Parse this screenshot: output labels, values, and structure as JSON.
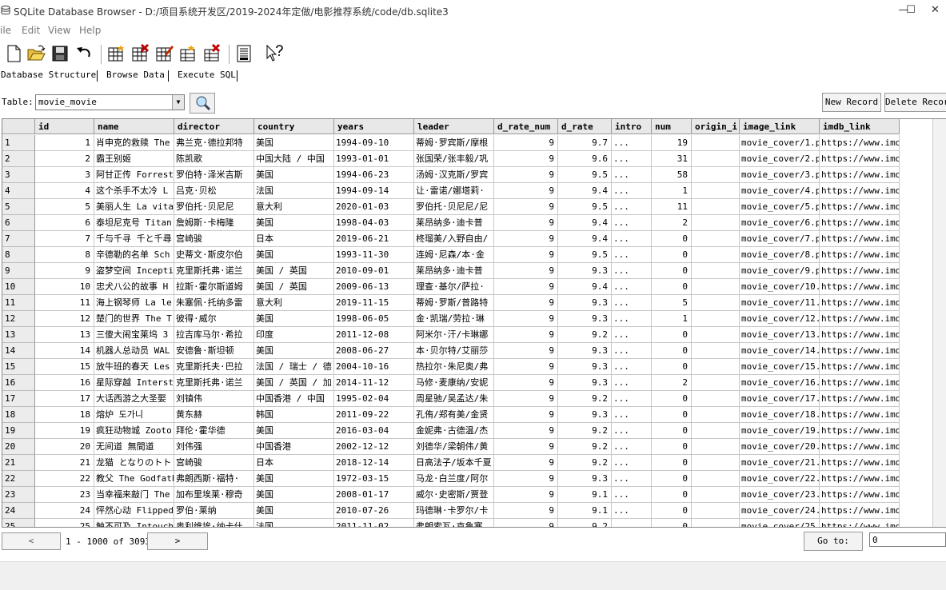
{
  "window": {
    "title": "SQLite Database Browser - D:/项目系统开发区/2019-2024年定做/电影推荐系统/code/db.sqlite3",
    "min": "—",
    "max": "☐",
    "close": "✕"
  },
  "menu": [
    "ile",
    "Edit",
    "View",
    "Help"
  ],
  "toolbar_icons": [
    "new-database-icon",
    "open-database-icon",
    "save-icon",
    "undo-icon",
    "create-table-icon",
    "delete-table-icon",
    "modify-table-icon",
    "create-index-icon",
    "delete-index-icon",
    "sql-log-icon",
    "whats-this-icon"
  ],
  "tabs": [
    "Database Structure",
    "Browse Data",
    "Execute SQL"
  ],
  "table_select": {
    "label": "Table:",
    "value": "movie_movie"
  },
  "buttons": {
    "new_record": "New Record",
    "delete_record": "Delete Recor"
  },
  "columns": [
    "id",
    "name",
    "director",
    "country",
    "years",
    "leader",
    "d_rate_num",
    "d_rate",
    "intro",
    "num",
    "origin_i",
    "image_link",
    "imdb_link"
  ],
  "rows": [
    [
      "1",
      "1",
      "肖申克的救赎 The",
      "弗兰克·德拉邦特",
      "美国",
      "1994-09-10",
      "蒂姆·罗宾斯/摩根",
      "9",
      "9.7",
      "...",
      "19",
      "",
      "movie_cover/1.pn",
      "https://www.imdb"
    ],
    [
      "2",
      "2",
      "霸王别姬",
      "陈凯歌",
      "中国大陆 / 中国",
      "1993-01-01",
      "张国荣/张丰毅/巩",
      "9",
      "9.6",
      "...",
      "31",
      "",
      "movie_cover/2.pn",
      "https://www.imdb"
    ],
    [
      "3",
      "3",
      "阿甘正传 Forrest",
      "罗伯特·泽米吉斯",
      "美国",
      "1994-06-23",
      "汤姆·汉克斯/罗宾",
      "9",
      "9.5",
      "...",
      "58",
      "",
      "movie_cover/3.pn",
      "https://www.imdb"
    ],
    [
      "4",
      "4",
      "这个杀手不太冷 L",
      "吕克·贝松",
      "法国",
      "1994-09-14",
      "让·雷诺/娜塔莉·",
      "9",
      "9.4",
      "...",
      "1",
      "",
      "movie_cover/4.pn",
      "https://www.imdb"
    ],
    [
      "5",
      "5",
      "美丽人生 La vita",
      "罗伯托·贝尼尼",
      "意大利",
      "2020-01-03",
      "罗伯托·贝尼尼/尼",
      "9",
      "9.5",
      "...",
      "11",
      "",
      "movie_cover/5.pn",
      "https://www.imdb"
    ],
    [
      "6",
      "6",
      "泰坦尼克号 Titan",
      "詹姆斯·卡梅隆",
      "美国",
      "1998-04-03",
      "莱昂纳多·迪卡普",
      "9",
      "9.4",
      "...",
      "2",
      "",
      "movie_cover/6.pn",
      "https://www.imdb"
    ],
    [
      "7",
      "7",
      "千与千寻 千と千尋",
      "宫崎骏",
      "日本",
      "2019-06-21",
      "柊瑠美/入野自由/",
      "9",
      "9.4",
      "...",
      "0",
      "",
      "movie_cover/7.pn",
      "https://www.imdb"
    ],
    [
      "8",
      "8",
      "辛德勒的名单 Sch",
      "史蒂文·斯皮尔伯",
      "美国",
      "1993-11-30",
      "连姆·尼森/本·金",
      "9",
      "9.5",
      "...",
      "0",
      "",
      "movie_cover/8.pn",
      "https://www.imdb"
    ],
    [
      "9",
      "9",
      "盗梦空间 Incepti",
      "克里斯托弗·诺兰",
      "美国 / 英国",
      "2010-09-01",
      "莱昂纳多·迪卡普",
      "9",
      "9.3",
      "...",
      "0",
      "",
      "movie_cover/9.pn",
      "https://www.imdb"
    ],
    [
      "10",
      "10",
      "忠犬八公的故事 H",
      "拉斯·霍尔斯道姆",
      "美国 / 英国",
      "2009-06-13",
      "理查·基尔/萨拉·",
      "9",
      "9.4",
      "...",
      "0",
      "",
      "movie_cover/10.p",
      "https://www.imdb"
    ],
    [
      "11",
      "11",
      "海上钢琴师 La le",
      "朱塞佩·托纳多雷",
      "意大利",
      "2019-11-15",
      "蒂姆·罗斯/普路特",
      "9",
      "9.3",
      "...",
      "5",
      "",
      "movie_cover/11.p",
      "https://www.imdb"
    ],
    [
      "12",
      "12",
      "楚门的世界 The T",
      "彼得·威尔",
      "美国",
      "1998-06-05",
      "金·凯瑞/劳拉·琳",
      "9",
      "9.3",
      "...",
      "1",
      "",
      "movie_cover/12.p",
      "https://www.imdb"
    ],
    [
      "13",
      "13",
      "三傻大闹宝莱坞 3",
      "拉吉库马尔·希拉",
      "印度",
      "2011-12-08",
      "阿米尔·汗/卡琳娜",
      "9",
      "9.2",
      "...",
      "0",
      "",
      "movie_cover/13.p",
      "https://www.imdb"
    ],
    [
      "14",
      "14",
      "机器人总动员 WAL",
      "安德鲁·斯坦顿",
      "美国",
      "2008-06-27",
      "本·贝尔特/艾丽莎",
      "9",
      "9.3",
      "...",
      "0",
      "",
      "movie_cover/14.p",
      "https://www.imdb"
    ],
    [
      "15",
      "15",
      "放牛班的春天 Les",
      "克里斯托夫·巴拉",
      "法国 / 瑞士 / 德",
      "2004-10-16",
      "热拉尔·朱尼奥/弗",
      "9",
      "9.3",
      "...",
      "0",
      "",
      "movie_cover/15.p",
      "https://www.imdb"
    ],
    [
      "16",
      "16",
      "星际穿越 Interst",
      "克里斯托弗·诺兰",
      "美国 / 英国 / 加",
      "2014-11-12",
      "马修·麦康纳/安妮",
      "9",
      "9.3",
      "...",
      "2",
      "",
      "movie_cover/16.p",
      "https://www.imdb"
    ],
    [
      "17",
      "17",
      "大话西游之大圣娶",
      "刘镇伟",
      "中国香港 / 中国",
      "1995-02-04",
      "周星驰/吴孟达/朱",
      "9",
      "9.2",
      "...",
      "0",
      "",
      "movie_cover/17.p",
      "https://www.imdb"
    ],
    [
      "18",
      "18",
      "熔炉 도가니",
      "黄东赫",
      "韩国",
      "2011-09-22",
      "孔侑/郑有美/金贤",
      "9",
      "9.3",
      "...",
      "0",
      "",
      "movie_cover/18.p",
      "https://www.imdb"
    ],
    [
      "19",
      "19",
      "疯狂动物城 Zooto",
      "拜伦·霍华德",
      "美国",
      "2016-03-04",
      "金妮弗·古德温/杰",
      "9",
      "9.2",
      "...",
      "0",
      "",
      "movie_cover/19.p",
      "https://www.imdb"
    ],
    [
      "20",
      "20",
      "无间道 無間道",
      "刘伟强",
      "中国香港",
      "2002-12-12",
      "刘德华/梁朝伟/黄",
      "9",
      "9.2",
      "...",
      "0",
      "",
      "movie_cover/20.p",
      "https://www.imdb"
    ],
    [
      "21",
      "21",
      "龙猫 となりのトト",
      "宫崎骏",
      "日本",
      "2018-12-14",
      "日高法子/坂本千夏",
      "9",
      "9.2",
      "...",
      "0",
      "",
      "movie_cover/21.p",
      "https://www.imdb"
    ],
    [
      "22",
      "22",
      "教父 The Godfath",
      "弗朗西斯·福特·",
      "美国",
      "1972-03-15",
      "马龙·白兰度/阿尔",
      "9",
      "9.3",
      "...",
      "0",
      "",
      "movie_cover/22.p",
      "https://www.imdb"
    ],
    [
      "23",
      "23",
      "当幸福来敲门 The",
      "加布里埃莱·穆奇",
      "美国",
      "2008-01-17",
      "威尔·史密斯/贾登",
      "9",
      "9.1",
      "...",
      "0",
      "",
      "movie_cover/23.p",
      "https://www.imdb"
    ],
    [
      "24",
      "24",
      "怦然心动 Flipped",
      "罗伯·莱纳",
      "美国",
      "2010-07-26",
      "玛德琳·卡罗尔/卡",
      "9",
      "9.1",
      "...",
      "0",
      "",
      "movie_cover/24.p",
      "https://www.imdb"
    ],
    [
      "25",
      "25",
      "触不可及 Intouch",
      "奥利维埃·纳卡什",
      "法国",
      "2011-11-02",
      "弗朗索瓦·克鲁塞",
      "9",
      "9.2",
      "...",
      "0",
      "",
      "movie_cover/25.p",
      "https://www.imdb"
    ]
  ],
  "nav": {
    "prev": "<",
    "range": "1 - 1000 of 3093",
    "next": ">",
    "goto_label": "Go to:",
    "goto_value": "0"
  }
}
